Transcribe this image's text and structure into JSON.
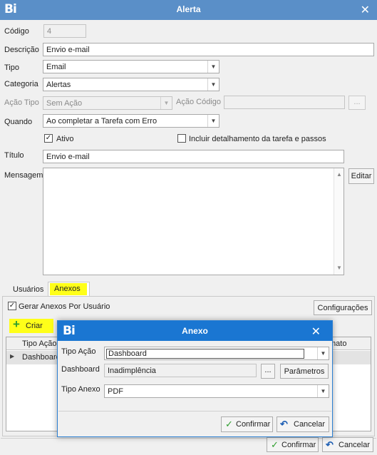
{
  "window": {
    "logo": "Bi",
    "title": "Alerta"
  },
  "form": {
    "codigo_label": "Código",
    "codigo_value": "4",
    "descricao_label": "Descrição",
    "descricao_value": "Envio e-mail",
    "tipo_label": "Tipo",
    "tipo_value": "Email",
    "categoria_label": "Categoria",
    "categoria_value": "Alertas",
    "acao_tipo_label": "Ação Tipo",
    "acao_tipo_value": "Sem Ação",
    "acao_codigo_label": "Ação Código",
    "acao_codigo_value": "",
    "ellipsis": "...",
    "quando_label": "Quando",
    "quando_value": "Ao completar a Tarefa com Erro",
    "ativo_label": "Ativo",
    "incluir_label": "Incluir detalhamento da tarefa e passos",
    "titulo_label": "Título",
    "titulo_value": "Envio e-mail",
    "mensagem_label": "Mensagem",
    "editar_label": "Editar"
  },
  "tabs": [
    {
      "label": "Usuários",
      "active": false
    },
    {
      "label": "Anexos",
      "active": true
    }
  ],
  "anexos": {
    "gerar_label": "Gerar Anexos Por Usuário",
    "configuracoes_label": "Configurações",
    "criar_label": "Criar",
    "columns": [
      "Tipo Ação",
      "mato"
    ],
    "rows": [
      {
        "tipo_acao": "Dashboard"
      }
    ]
  },
  "footer": {
    "confirmar_label": "Confirmar",
    "cancelar_label": "Cancelar"
  },
  "dialog": {
    "logo": "Bi",
    "title": "Anexo",
    "tipo_acao_label": "Tipo Ação",
    "tipo_acao_value": "Dashboard",
    "dashboard_label": "Dashboard",
    "dashboard_value": "Inadimplência",
    "ellipsis": "...",
    "parametros_label": "Parâmetros",
    "tipo_anexo_label": "Tipo Anexo",
    "tipo_anexo_value": "PDF",
    "confirmar_label": "Confirmar",
    "cancelar_label": "Cancelar"
  },
  "colors": {
    "titlebar": "#5a8fc8",
    "dialog_titlebar": "#1a76d2",
    "highlight": "#ffff19",
    "confirm_check": "#2e9e2e",
    "cancel_arrow": "#1e5fb4"
  },
  "icons": [
    "close-icon",
    "dropdown-arrow-icon",
    "check-icon",
    "plus-icon",
    "undo-arrow-icon",
    "scroll-up-icon",
    "scroll-down-icon",
    "row-indicator-icon"
  ]
}
